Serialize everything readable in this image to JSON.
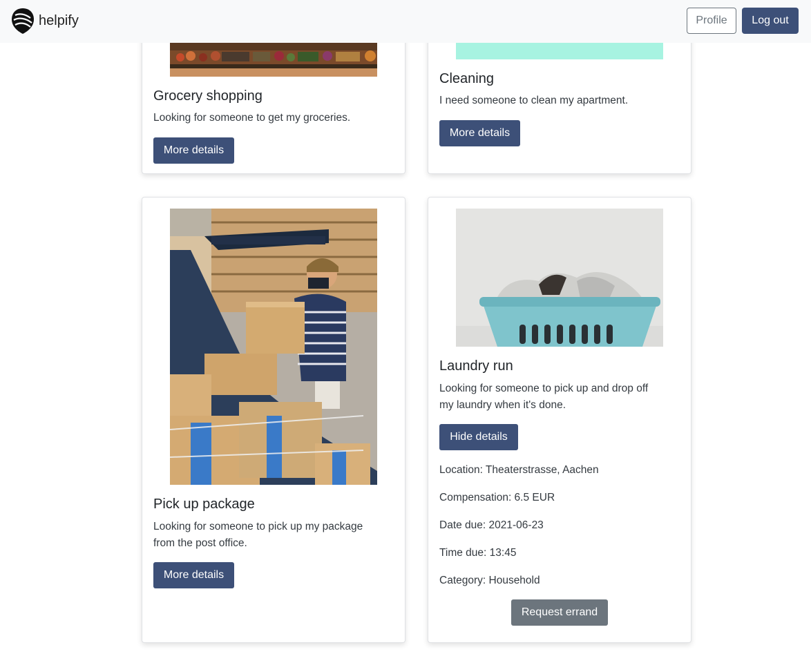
{
  "navbar": {
    "brand": "helpify",
    "profile_label": "Profile",
    "logout_label": "Log out"
  },
  "cards": [
    {
      "title": "Grocery shopping",
      "text": "Looking for someone to get my groceries.",
      "button": "More details"
    },
    {
      "title": "Cleaning",
      "text": "I need someone to clean my apartment.",
      "button": "More details"
    },
    {
      "title": "Pick up package",
      "text_line1": "Looking for someone to pick up my package",
      "text_line2": "from the post office.",
      "button": "More details"
    },
    {
      "title": "Laundry run",
      "text_line1": "Looking for someone to pick up and drop off",
      "text_line2": "my laundry when it's done.",
      "button": "Hide details",
      "details": {
        "location": "Location: Theaterstrasse, Aachen",
        "compensation": "Compensation: 6.5 EUR",
        "date_due": "Date due: 2021-06-23",
        "time_due": "Time due: 13:45",
        "category": "Category: Household"
      },
      "request_button": "Request errand"
    }
  ],
  "colors": {
    "primary": "#3d5078",
    "secondary": "#6c757d",
    "navbar_bg": "#f8f9fa",
    "cleaning_image": "#a7f3e1"
  }
}
